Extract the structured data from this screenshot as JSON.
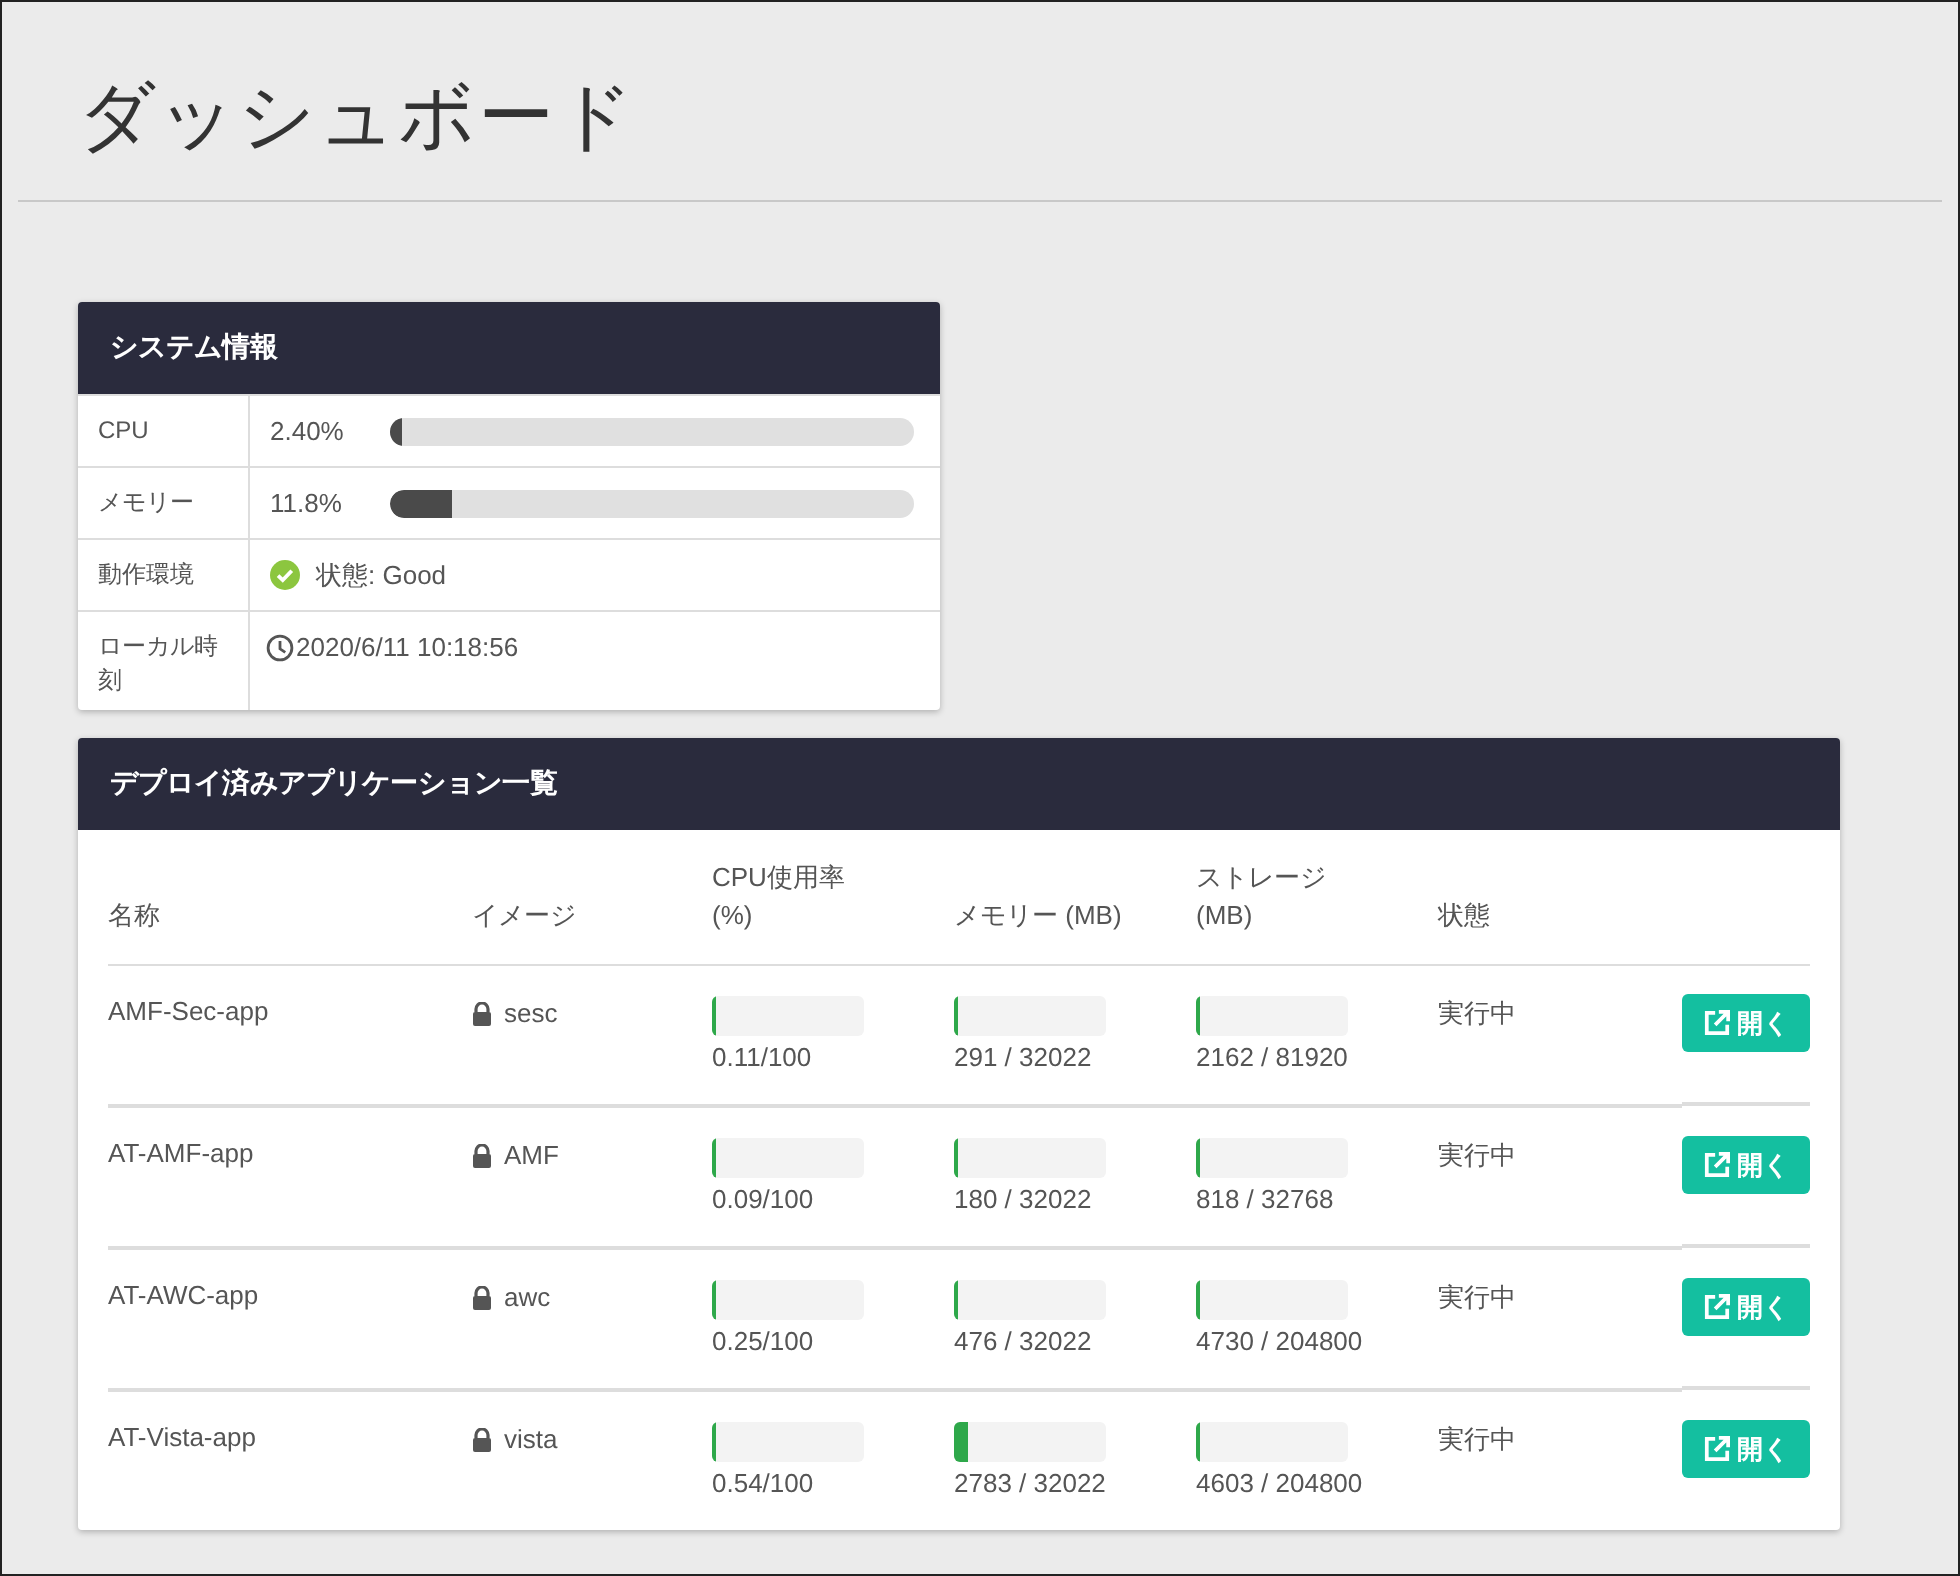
{
  "page_title": "ダッシュボード",
  "system_info": {
    "title": "システム情報",
    "rows": [
      {
        "kind": "meter",
        "label": "CPU",
        "reading": "2.40%",
        "level": 0.024
      },
      {
        "kind": "meter",
        "label": "メモリー",
        "reading": "11.8%",
        "level": 0.118
      },
      {
        "kind": "status",
        "label": "動作環境",
        "value": "状態: Good"
      },
      {
        "kind": "time",
        "label": "ローカル時刻",
        "value": "2020/6/11 10:18:56"
      }
    ]
  },
  "apps": {
    "title": "デプロイ済みアプリケーション一覧",
    "columns": [
      "名称",
      "イメージ",
      "CPU使用率 (%)",
      "メモリー (MB)",
      "ストレージ (MB)",
      "状態"
    ],
    "rows": [
      {
        "name": "AMF-Sec-app",
        "image": "sesc",
        "cpu": {
          "level": 0.0011,
          "reading": "0.11/100"
        },
        "memory": {
          "level": 0.009,
          "reading": "291 / 32022"
        },
        "storage": {
          "level": 0.026,
          "reading": "2162 / 81920"
        },
        "status": "実行中",
        "button": "開く"
      },
      {
        "name": "AT-AMF-app",
        "image": "AMF",
        "cpu": {
          "level": 0.0009,
          "reading": "0.09/100"
        },
        "memory": {
          "level": 0.0056,
          "reading": "180 / 32022"
        },
        "storage": {
          "level": 0.025,
          "reading": "818 / 32768"
        },
        "status": "実行中",
        "button": "開く"
      },
      {
        "name": "AT-AWC-app",
        "image": "awc",
        "cpu": {
          "level": 0.0025,
          "reading": "0.25/100"
        },
        "memory": {
          "level": 0.0149,
          "reading": "476 / 32022"
        },
        "storage": {
          "level": 0.023,
          "reading": "4730 / 204800"
        },
        "status": "実行中",
        "button": "開く"
      },
      {
        "name": "AT-Vista-app",
        "image": "vista",
        "cpu": {
          "level": 0.0054,
          "reading": "0.54/100"
        },
        "memory": {
          "level": 0.087,
          "reading": "2783 / 32022"
        },
        "storage": {
          "level": 0.022,
          "reading": "4603 / 204800"
        },
        "status": "実行中",
        "button": "開く"
      }
    ]
  }
}
